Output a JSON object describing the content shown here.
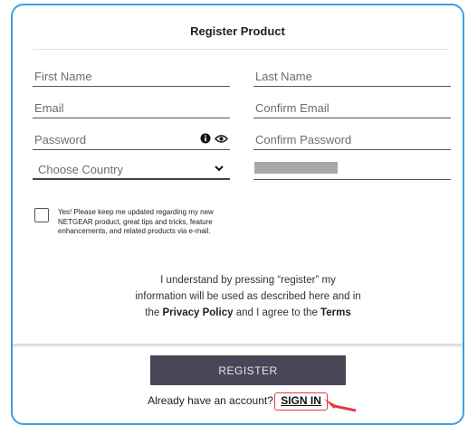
{
  "form": {
    "title": "Register Product",
    "fields": {
      "first_name": "First Name",
      "last_name": "Last Name",
      "email": "Email",
      "confirm_email": "Confirm Email",
      "password": "Password",
      "confirm_password": "Confirm Password",
      "country": "Choose Country"
    },
    "optin_text": "Yes! Please keep me updated regarding my new NETGEAR product, great tips and tricks, feature enhancements, and related products via e-mail.",
    "legal": {
      "line1": "I understand by pressing “register” my",
      "line2": "information will be used as described here and in",
      "line3_pre": "the",
      "privacy_link": "Privacy Policy",
      "line3_mid": "and I agree to the",
      "terms_link": "Terms"
    },
    "register_label": "REGISTER",
    "already_text": "Already have an account?",
    "signin_label": "SIGN IN"
  },
  "colors": {
    "accent_border": "#3ba0e3",
    "button": "#4b4558",
    "highlight": "#e03c44"
  }
}
